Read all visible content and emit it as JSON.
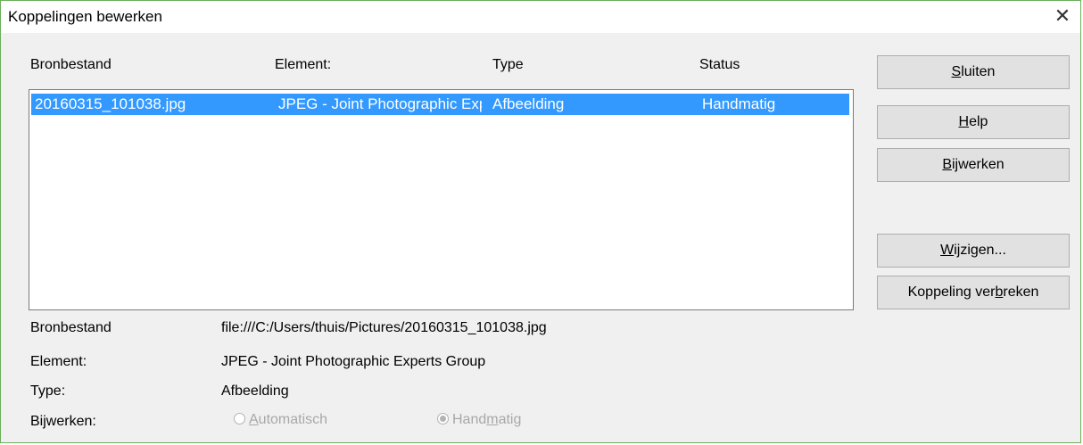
{
  "window": {
    "title": "Koppelingen bewerken",
    "close_icon": "close-icon"
  },
  "columns": [
    "Bronbestand",
    "Element:",
    "Type",
    "Status"
  ],
  "rows": [
    {
      "source": "20160315_101038.jpg",
      "element": "JPEG - Joint Photographic Experts Group",
      "type": "Afbeelding",
      "status": "Handmatig"
    }
  ],
  "buttons": {
    "close": {
      "pre": "",
      "key": "S",
      "post": "luiten"
    },
    "help": {
      "pre": "",
      "key": "H",
      "post": "elp"
    },
    "update": {
      "pre": "",
      "key": "B",
      "post": "ijwerken"
    },
    "modify": {
      "pre": "",
      "key": "W",
      "post": "ijzigen..."
    },
    "break": {
      "pre": "Koppeling ver",
      "key": "b",
      "post": "reken"
    }
  },
  "details": {
    "source_label": "Bronbestand",
    "source_value": "file:///C:/Users/thuis/Pictures/20160315_101038.jpg",
    "element_label": "Element:",
    "element_value": "JPEG - Joint Photographic Experts Group",
    "type_label": "Type:",
    "type_value": "Afbeelding",
    "update_label": "Bijwerken:"
  },
  "update_mode": {
    "automatic": {
      "pre": "",
      "key": "A",
      "post": "utomatisch",
      "selected": false
    },
    "manual": {
      "pre": "Hand",
      "key": "m",
      "post": "atig",
      "selected": true
    }
  }
}
